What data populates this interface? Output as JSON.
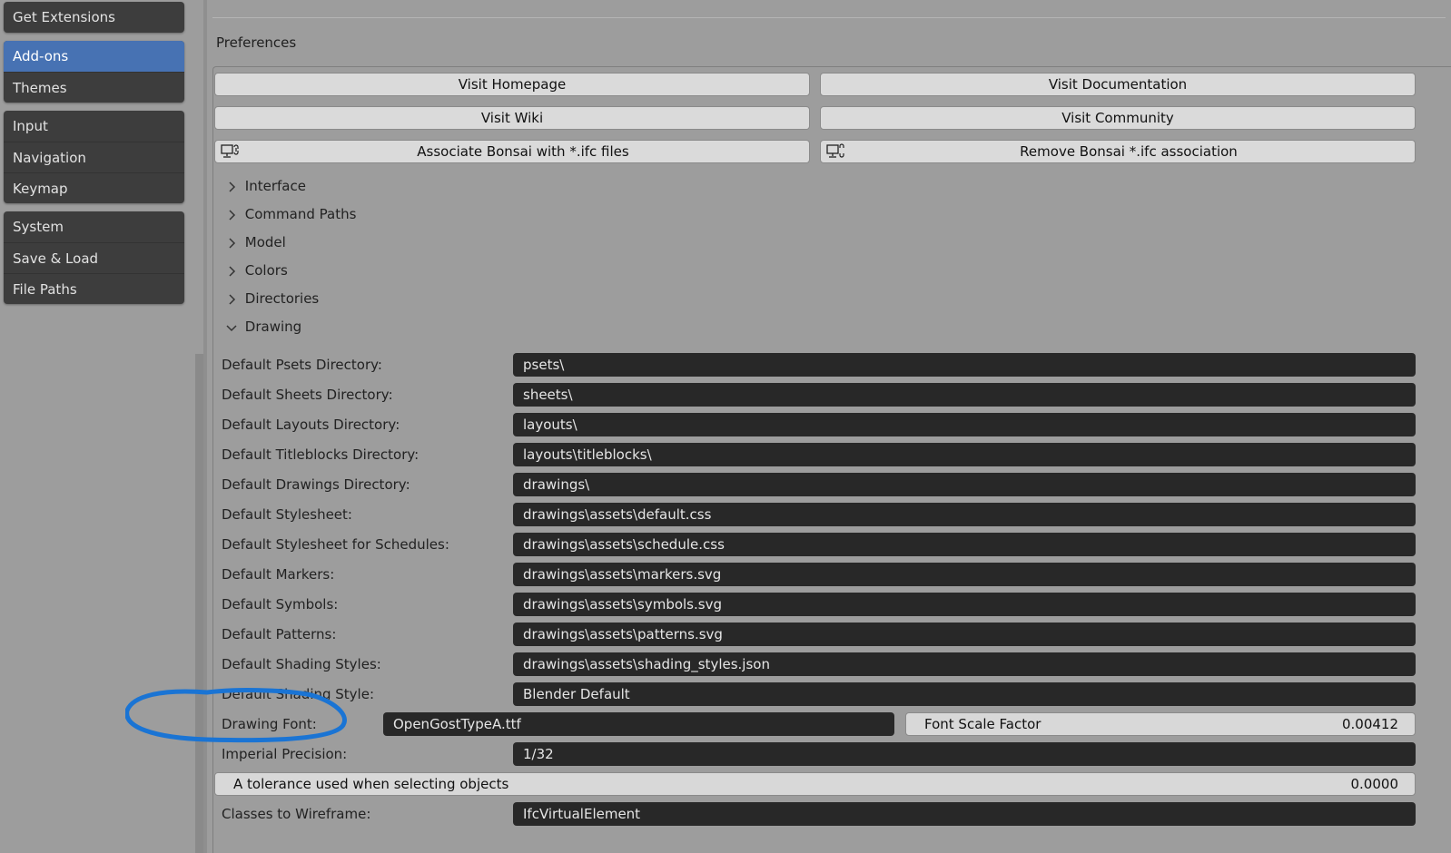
{
  "sidebar": {
    "groups": [
      [
        {
          "label": "Get Extensions"
        }
      ],
      [
        {
          "label": "Add-ons",
          "active": true
        },
        {
          "label": "Themes"
        }
      ],
      [
        {
          "label": "Input"
        },
        {
          "label": "Navigation"
        },
        {
          "label": "Keymap"
        }
      ],
      [
        {
          "label": "System"
        },
        {
          "label": "Save & Load"
        },
        {
          "label": "File Paths"
        }
      ]
    ]
  },
  "main": {
    "preferences_label": "Preferences",
    "buttons": {
      "visit_homepage": "Visit Homepage",
      "visit_documentation": "Visit Documentation",
      "visit_wiki": "Visit Wiki",
      "visit_community": "Visit Community",
      "associate": "Associate Bonsai with *.ifc files",
      "remove_association": "Remove Bonsai *.ifc association"
    },
    "sections": [
      {
        "label": "Interface",
        "expanded": false
      },
      {
        "label": "Command Paths",
        "expanded": false
      },
      {
        "label": "Model",
        "expanded": false
      },
      {
        "label": "Colors",
        "expanded": false
      },
      {
        "label": "Directories",
        "expanded": false
      },
      {
        "label": "Drawing",
        "expanded": true
      }
    ],
    "drawing": {
      "rows": [
        {
          "label": "Default Psets Directory:",
          "value": "psets\\"
        },
        {
          "label": "Default Sheets Directory:",
          "value": "sheets\\"
        },
        {
          "label": "Default Layouts Directory:",
          "value": "layouts\\"
        },
        {
          "label": "Default Titleblocks Directory:",
          "value": "layouts\\titleblocks\\"
        },
        {
          "label": "Default Drawings Directory:",
          "value": "drawings\\"
        },
        {
          "label": "Default Stylesheet:",
          "value": "drawings\\assets\\default.css"
        },
        {
          "label": "Default Stylesheet for Schedules:",
          "value": "drawings\\assets\\schedule.css"
        },
        {
          "label": "Default Markers:",
          "value": "drawings\\assets\\markers.svg"
        },
        {
          "label": "Default Symbols:",
          "value": "drawings\\assets\\symbols.svg"
        },
        {
          "label": "Default Patterns:",
          "value": "drawings\\assets\\patterns.svg"
        },
        {
          "label": "Default Shading Styles:",
          "value": "drawings\\assets\\shading_styles.json"
        },
        {
          "label": "Default Shading Style:",
          "value": "Blender Default"
        }
      ],
      "drawing_font": {
        "label": "Drawing Font:",
        "value": "OpenGostTypeA.ttf"
      },
      "font_scale": {
        "label": "Font Scale Factor",
        "value": "0.00412"
      },
      "imperial_precision": {
        "label": "Imperial Precision:",
        "value": "1/32"
      },
      "tolerance": {
        "label": "A tolerance used when selecting objects",
        "value": "0.0000"
      },
      "classes_to_wireframe": {
        "label": "Classes to Wireframe:",
        "value": "IfcVirtualElement"
      }
    }
  },
  "colors": {
    "accent": "#4772b3",
    "background": "#9d9d9d",
    "field": "#282828",
    "button": "#dadada",
    "annotation": "#1a74d4"
  },
  "icons": {
    "associate": "monitor-link-icon",
    "remove": "monitor-unlink-icon",
    "collapsed": "chevron-right-icon",
    "expanded": "chevron-down-icon"
  }
}
